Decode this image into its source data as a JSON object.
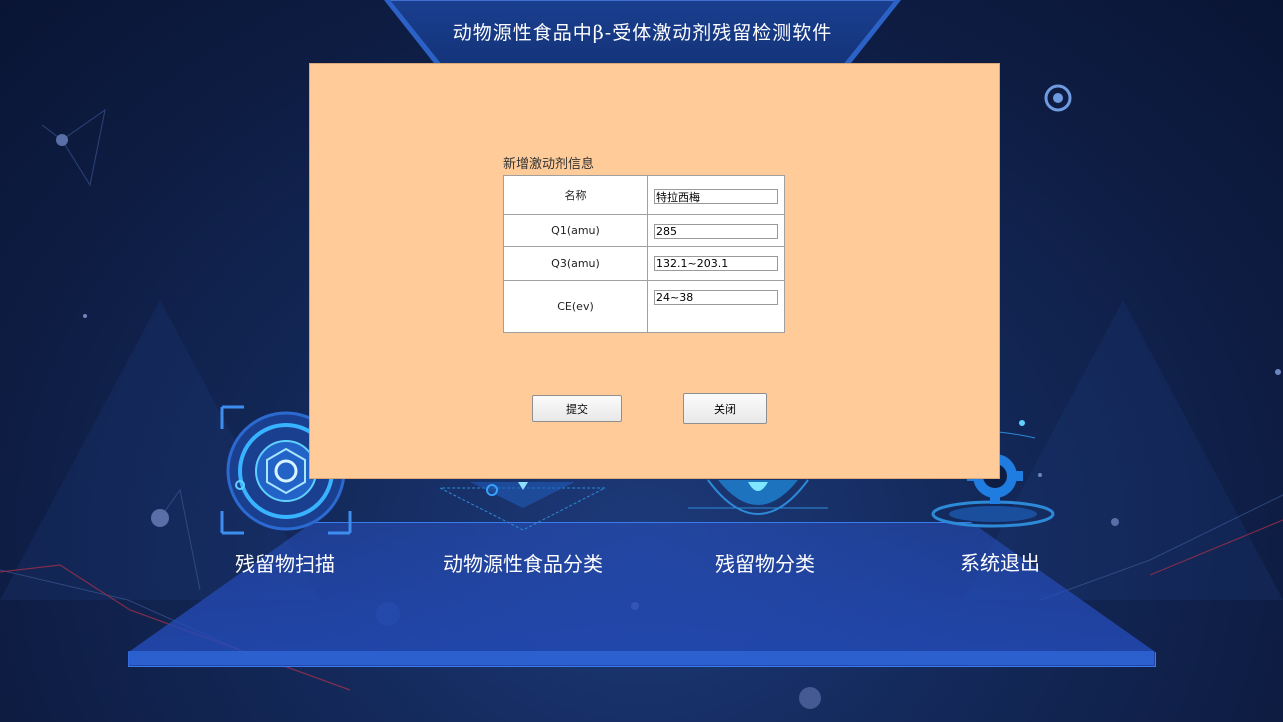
{
  "app": {
    "title": "动物源性食品中β-受体激动剂残留检测软件"
  },
  "menu": {
    "items": [
      {
        "label": "残留物扫描",
        "icon": "scan-icon"
      },
      {
        "label": "动物源性食品分类",
        "icon": "food-category-icon"
      },
      {
        "label": "残留物分类",
        "icon": "residue-category-icon"
      },
      {
        "label": "系统退出",
        "icon": "exit-gear-icon"
      }
    ]
  },
  "dialog": {
    "form_title": "新增激动剂信息",
    "rows": [
      {
        "label": "名称",
        "value": "特拉西梅"
      },
      {
        "label": "Q1(amu)",
        "value": "285"
      },
      {
        "label": "Q3(amu)",
        "value": "132.1~203.1"
      },
      {
        "label": "CE(ev)",
        "value": "24~38"
      }
    ],
    "submit_label": "提交",
    "close_label": "关闭"
  },
  "colors": {
    "background": "#0e1d44",
    "dialog_bg": "#ffcb99",
    "accent": "#2c62c8"
  }
}
